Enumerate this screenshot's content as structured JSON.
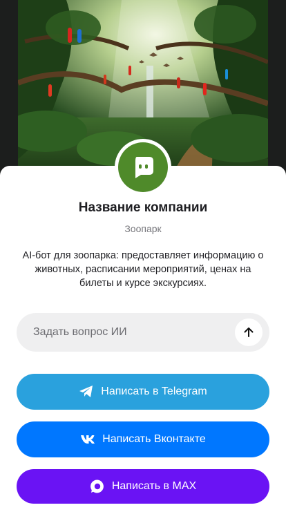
{
  "profile": {
    "company_name": "Название компании",
    "category": "Зоопарк",
    "description": "AI-бот для зоопарка: предоставляет информацию о животных, расписании мероприятий, ценах на билеты и курсе экскурсиях."
  },
  "ask": {
    "placeholder": "Задать вопрос ИИ",
    "send_icon": "arrow-up-icon"
  },
  "buttons": {
    "telegram": {
      "label": "Написать в Telegram",
      "icon": "telegram-icon",
      "color": "#2aa1dd"
    },
    "vk": {
      "label": "Написать Вконтакте",
      "icon": "vk-icon",
      "color": "#0077ff"
    },
    "max": {
      "label": "Написать в MAX",
      "icon": "max-icon",
      "color": "#6a13f4"
    }
  },
  "colors": {
    "avatar_bg": "#4f8a2a",
    "page_bg": "#ffffff",
    "input_bg": "#efeff0"
  }
}
